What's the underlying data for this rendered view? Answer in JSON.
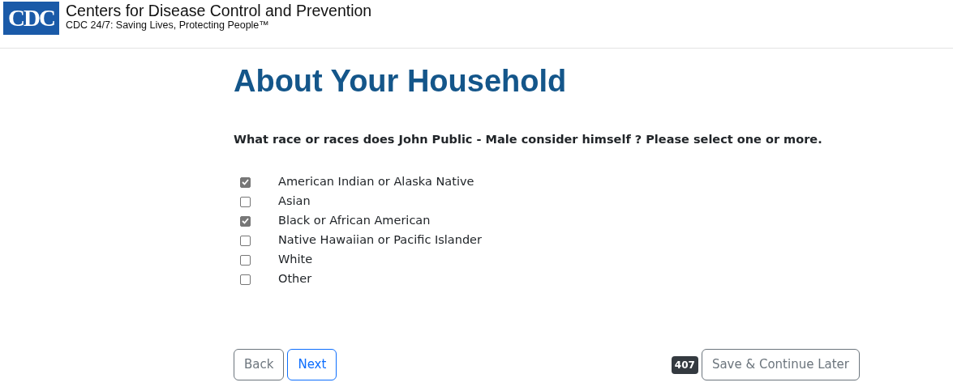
{
  "header": {
    "logo_text": "CDC",
    "title": "Centers for Disease Control and Prevention",
    "tagline": "CDC 24/7: Saving Lives, Protecting People™"
  },
  "heading": "About Your Household",
  "question": "What race or races does John Public - Male consider himself ? Please select one or more.",
  "options": [
    {
      "label": "American Indian or Alaska Native",
      "checked": true
    },
    {
      "label": "Asian",
      "checked": false
    },
    {
      "label": "Black or African American",
      "checked": true
    },
    {
      "label": "Native Hawaiian or Pacific Islander",
      "checked": false
    },
    {
      "label": "White",
      "checked": false
    },
    {
      "label": "Other",
      "checked": false
    }
  ],
  "buttons": {
    "back": "Back",
    "next": "Next",
    "badge": "407",
    "save": "Save & Continue Later"
  }
}
